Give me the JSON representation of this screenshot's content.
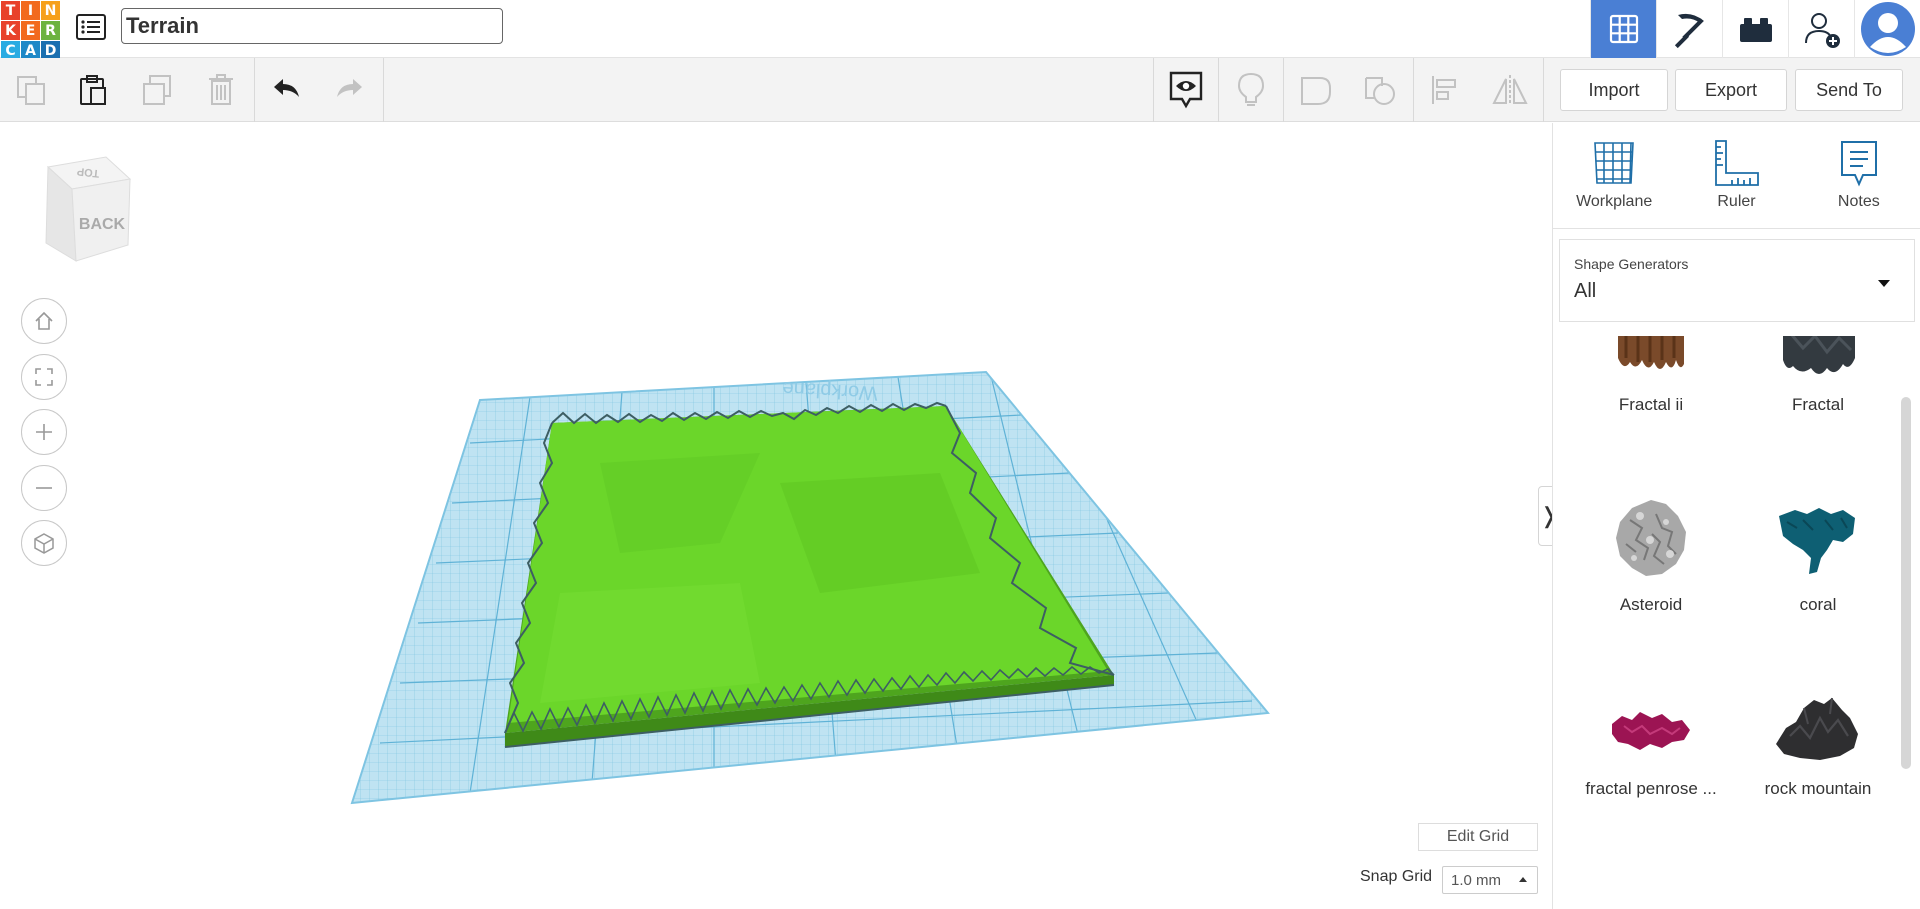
{
  "logo": {
    "letters": [
      "T",
      "I",
      "N",
      "K",
      "E",
      "R",
      "C",
      "A",
      "D"
    ],
    "colors": [
      "#e8412b",
      "#f26a1e",
      "#f6a01a",
      "#e8412b",
      "#f26a1e",
      "#6cb33f",
      "#29abe2",
      "#1e88c7",
      "#1a6fb0"
    ]
  },
  "header": {
    "design_title": "Terrain",
    "right_buttons": [
      "grid-view-icon",
      "pickaxe-icon",
      "brick-icon",
      "add-user-icon",
      "account-icon"
    ]
  },
  "toolbar": {
    "import_label": "Import",
    "export_label": "Export",
    "send_to_label": "Send To"
  },
  "view_cube": {
    "top_label": "TOP",
    "front_label": "BACK"
  },
  "workplane_text": "Workplane",
  "bottom": {
    "edit_grid_label": "Edit Grid",
    "snap_grid_label": "Snap Grid",
    "snap_grid_value": "1.0 mm"
  },
  "panel": {
    "tools": [
      {
        "label": "Workplane",
        "icon": "workplane-icon"
      },
      {
        "label": "Ruler",
        "icon": "ruler-icon"
      },
      {
        "label": "Notes",
        "icon": "notes-icon"
      }
    ],
    "generator_label": "Shape Generators",
    "generator_value": "All",
    "shapes": [
      {
        "label": "Fractal ii",
        "color": "#7a4a2a"
      },
      {
        "label": "Fractal",
        "color": "#333a40"
      },
      {
        "label": "Asteroid",
        "color": "#9a9a9a"
      },
      {
        "label": "coral",
        "color": "#0e5f73"
      },
      {
        "label": "fractal penrose ...",
        "color": "#9c1453"
      },
      {
        "label": "rock mountain",
        "color": "#2e2e30"
      }
    ]
  },
  "colors": {
    "accent": "#4a7fd4",
    "terrain": "#6bd62a",
    "workplane": "#a8d8ee"
  }
}
